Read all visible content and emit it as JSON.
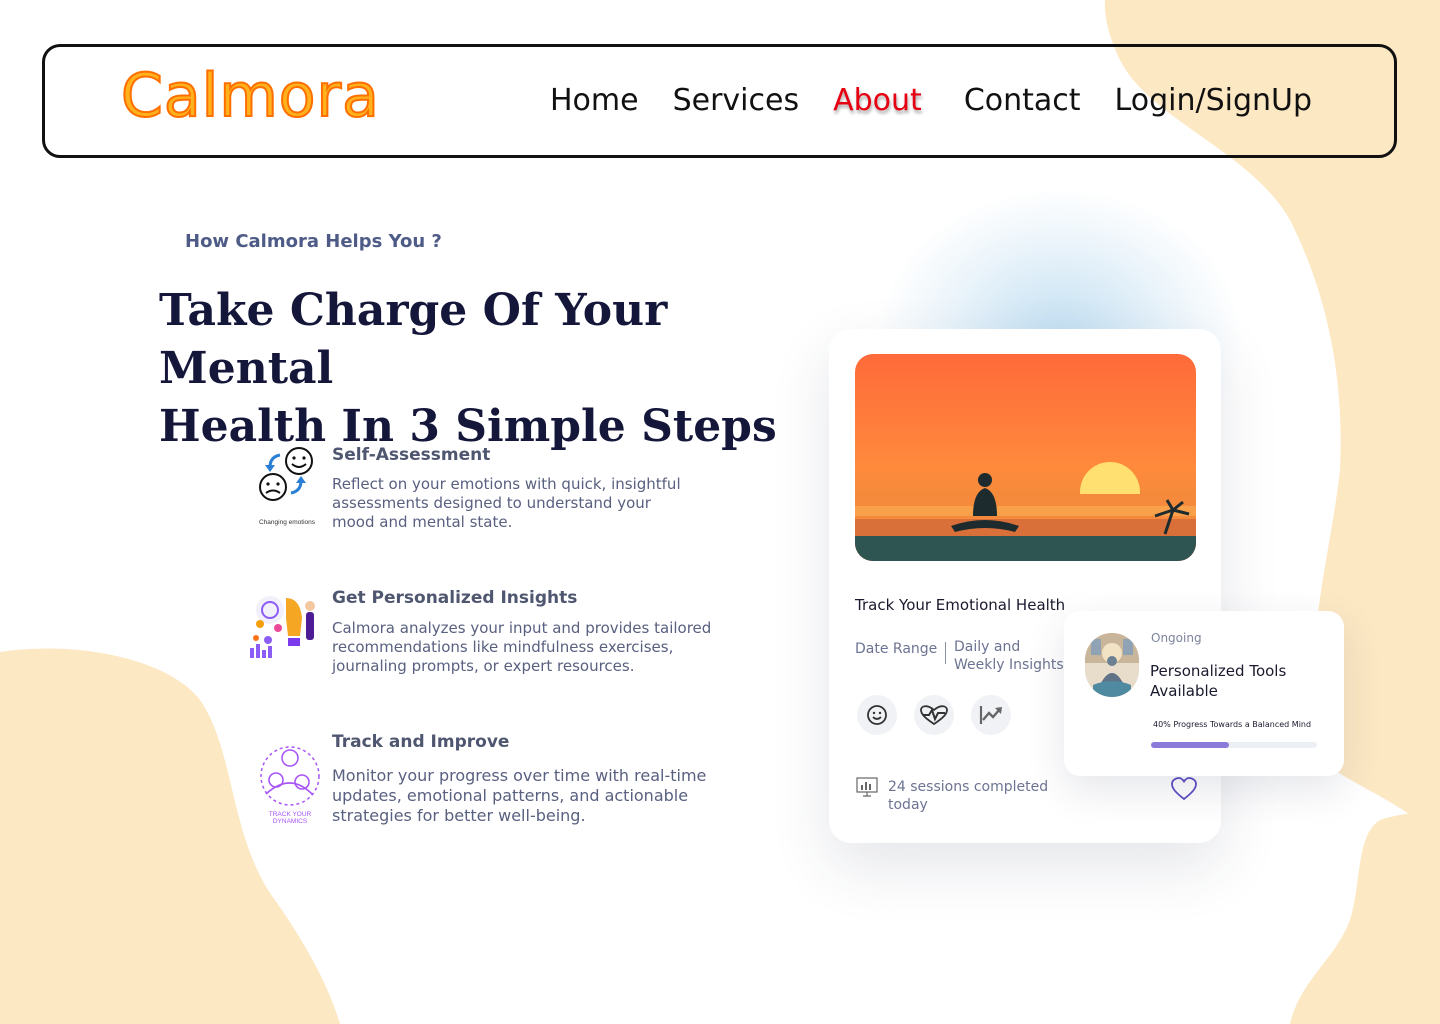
{
  "nav": {
    "logo": "Calmora",
    "links": [
      {
        "label": "Home",
        "active": false
      },
      {
        "label": "Services",
        "active": false
      },
      {
        "label": "About",
        "active": true
      },
      {
        "label": "Contact",
        "active": false
      },
      {
        "label": "Login/SignUp",
        "active": false
      }
    ]
  },
  "hero": {
    "eyebrow": "How Calmora Helps You ?",
    "headline_line1": "Take Charge Of Your Mental",
    "headline_line2": "Health In 3 Simple Steps"
  },
  "steps": [
    {
      "icon": "changing-emotions-icon",
      "icon_caption": "Changing emotions",
      "title": "Self-Assessment",
      "desc_lines": [
        "Reflect on your emotions with quick, insightful",
        "assessments designed to understand your",
        "mood and mental state."
      ]
    },
    {
      "icon": "personalized-insights-icon",
      "title": "Get Personalized Insights",
      "desc_lines": [
        "Calmora analyzes your input and provides tailored",
        "recommendations like mindfulness exercises,",
        "journaling prompts, or expert resources."
      ]
    },
    {
      "icon": "track-dynamics-icon",
      "icon_caption_line1": "TRACK YOUR",
      "icon_caption_line2": "DYNAMICS",
      "title": "Track and Improve",
      "desc_lines": [
        "Monitor your progress over time with real-time",
        "updates, emotional patterns, and actionable",
        "strategies for better well-being."
      ]
    }
  ],
  "card": {
    "image": "meditation-sunset-image",
    "title": "Track Your Emotional Health",
    "range_label": "Date Range",
    "range_value_line1": "Daily and",
    "range_value_line2": "Weekly Insights",
    "actions": [
      "smile-icon",
      "heartbeat-icon",
      "trend-up-icon"
    ],
    "sessions_line1": "24 sessions completed",
    "sessions_line2": "today",
    "heart": "heart-icon"
  },
  "sub_card": {
    "status": "Ongoing",
    "title_line1": "Personalized Tools",
    "title_line2": "Available",
    "progress_label": "40% Progress Towards a Balanced Mind",
    "progress": 0.47
  },
  "colors": {
    "brand": "#ffb21c",
    "active_link": "#e60012",
    "heading": "#14163a",
    "blob": "#fde8c4",
    "progress": "#8b7ad8"
  }
}
